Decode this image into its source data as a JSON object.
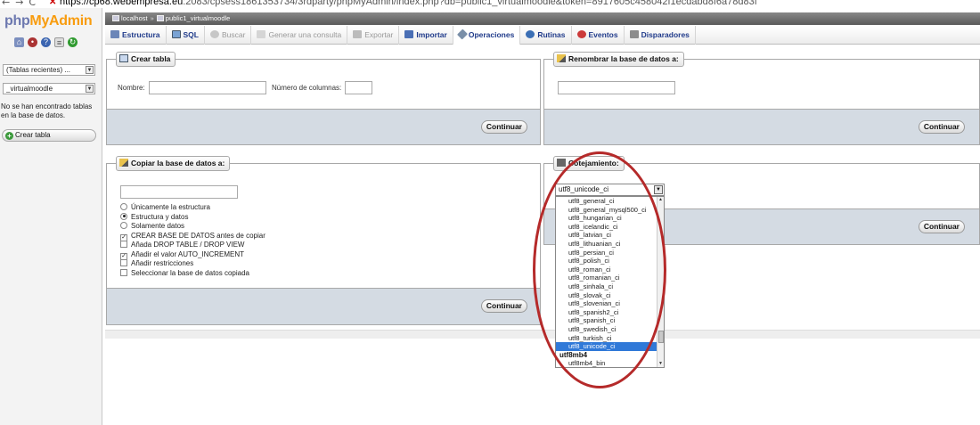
{
  "browser": {
    "url_host": "https://cp68.webempresa.eu",
    "url_rest": ":2083/cpsess1861353734/3rdparty/phpMyAdmin/index.php?db=public1_virtualmoodle&token=8917605c458042f1ecdabd8f6a78d83f"
  },
  "logo": {
    "part1": "php",
    "part2": "MyAdmin"
  },
  "sidebar": {
    "recent_tables": "(Tablas recientes) ...",
    "database": "_virtualmoodle",
    "no_tables": "No se han encontrado tablas en la base de datos.",
    "create_table": "Crear tabla"
  },
  "breadcrumb": {
    "server": "localhost",
    "separator": "»",
    "database": "public1_virtualmoodle"
  },
  "tabs": [
    {
      "label": "Estructura",
      "icon": "structure-icon",
      "disabled": false
    },
    {
      "label": "SQL",
      "icon": "sql-icon",
      "disabled": false
    },
    {
      "label": "Buscar",
      "icon": "search-icon",
      "disabled": true
    },
    {
      "label": "Generar una consulta",
      "icon": "query-icon",
      "disabled": true
    },
    {
      "label": "Exportar",
      "icon": "export-icon",
      "disabled": true
    },
    {
      "label": "Importar",
      "icon": "import-icon",
      "disabled": false
    },
    {
      "label": "Operaciones",
      "icon": "operations-icon",
      "disabled": false,
      "active": true
    },
    {
      "label": "Rutinas",
      "icon": "routines-icon",
      "disabled": false
    },
    {
      "label": "Eventos",
      "icon": "events-icon",
      "disabled": false
    },
    {
      "label": "Disparadores",
      "icon": "triggers-icon",
      "disabled": false
    }
  ],
  "create_table": {
    "legend": "Crear tabla",
    "name_label": "Nombre:",
    "columns_label": "Número de columnas:",
    "button": "Continuar"
  },
  "rename_db": {
    "legend": "Renombrar la base de datos a:",
    "button": "Continuar"
  },
  "copy_db": {
    "legend": "Copiar la base de datos a:",
    "options": [
      {
        "type": "radio",
        "label": "Únicamente la estructura",
        "checked": false
      },
      {
        "type": "radio",
        "label": "Estructura y datos",
        "checked": true
      },
      {
        "type": "radio",
        "label": "Solamente datos",
        "checked": false
      },
      {
        "type": "checkbox",
        "label": "CREAR BASE DE DATOS antes de copiar",
        "checked": true
      },
      {
        "type": "checkbox",
        "label": "Añada DROP TABLE / DROP VIEW",
        "checked": false
      },
      {
        "type": "checkbox",
        "label": "Añadir el valor AUTO_INCREMENT",
        "checked": true
      },
      {
        "type": "checkbox",
        "label": "Añadir restricciones",
        "checked": false
      },
      {
        "type": "checkbox",
        "label": "Seleccionar la base de datos copiada",
        "checked": false
      }
    ],
    "button": "Continuar"
  },
  "collation": {
    "legend": "Cotejamiento:",
    "selected": "utf8_unicode_ci",
    "button": "Continuar",
    "list": [
      {
        "label": "utf8_general_ci"
      },
      {
        "label": "utf8_general_mysql500_ci"
      },
      {
        "label": "utf8_hungarian_ci"
      },
      {
        "label": "utf8_icelandic_ci"
      },
      {
        "label": "utf8_latvian_ci"
      },
      {
        "label": "utf8_lithuanian_ci"
      },
      {
        "label": "utf8_persian_ci"
      },
      {
        "label": "utf8_polish_ci"
      },
      {
        "label": "utf8_roman_ci"
      },
      {
        "label": "utf8_romanian_ci"
      },
      {
        "label": "utf8_sinhala_ci"
      },
      {
        "label": "utf8_slovak_ci"
      },
      {
        "label": "utf8_slovenian_ci"
      },
      {
        "label": "utf8_spanish2_ci"
      },
      {
        "label": "utf8_spanish_ci"
      },
      {
        "label": "utf8_swedish_ci"
      },
      {
        "label": "utf8_turkish_ci"
      },
      {
        "label": "utf8_unicode_ci",
        "selected": true
      },
      {
        "label": "utf8mb4",
        "group": true
      },
      {
        "label": "utf8mb4_bin"
      }
    ]
  },
  "colors": {
    "annotation": "#b52a2a",
    "selection": "#3079d8",
    "footer": "#d4dbe3"
  }
}
